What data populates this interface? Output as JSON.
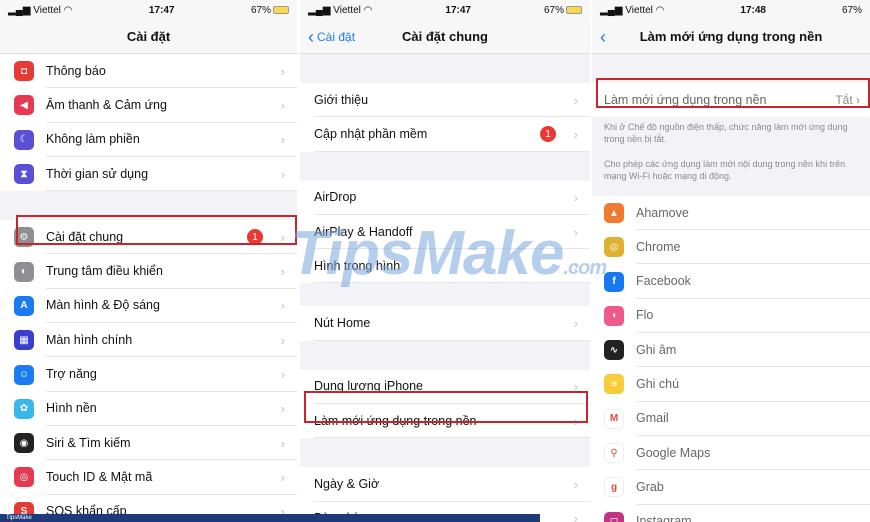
{
  "panel1": {
    "status": {
      "carrier": "Viettel",
      "time": "17:47",
      "battery": "67%"
    },
    "title": "Cài đặt",
    "group1": [
      {
        "label": "Thông báo",
        "icon": "bell-icon",
        "color": "#e63a35"
      },
      {
        "label": "Âm thanh & Cảm ứng",
        "icon": "speaker-icon",
        "color": "#e63a53"
      },
      {
        "label": "Không làm phiền",
        "icon": "moon-icon",
        "color": "#5b4fd6"
      },
      {
        "label": "Thời gian sử dụng",
        "icon": "hourglass-icon",
        "color": "#5b4fd6"
      }
    ],
    "group2": [
      {
        "label": "Cài đặt chung",
        "icon": "gear-icon",
        "color": "#8e8e93",
        "badge": "1"
      },
      {
        "label": "Trung tâm điều khiển",
        "icon": "toggles-icon",
        "color": "#8e8e93"
      },
      {
        "label": "Màn hình & Độ sáng",
        "icon": "text-size-icon",
        "color": "#1a7cf0"
      },
      {
        "label": "Màn hình chính",
        "icon": "grid-icon",
        "color": "#3b3fd0"
      },
      {
        "label": "Trợ năng",
        "icon": "accessibility-icon",
        "color": "#1a7cf0"
      },
      {
        "label": "Hình nền",
        "icon": "flower-icon",
        "color": "#38b8e8"
      },
      {
        "label": "Siri & Tìm kiếm",
        "icon": "siri-icon",
        "color": "#222"
      },
      {
        "label": "Touch ID & Mật mã",
        "icon": "fingerprint-icon",
        "color": "#e63a53"
      },
      {
        "label": "SOS khẩn cấp",
        "icon": "sos-icon",
        "color": "#e63a35"
      }
    ]
  },
  "panel2": {
    "status": {
      "carrier": "Viettel",
      "time": "17:47",
      "battery": "67%"
    },
    "back": "Cài đặt",
    "title": "Cài đặt chung",
    "group1": [
      {
        "label": "Giới thiệu"
      },
      {
        "label": "Cập nhật phần mềm",
        "badge": "1"
      }
    ],
    "group2": [
      {
        "label": "AirDrop"
      },
      {
        "label": "AirPlay & Handoff"
      },
      {
        "label": "Hình trong hình"
      }
    ],
    "group3": [
      {
        "label": "Nút Home"
      }
    ],
    "group4": [
      {
        "label": "Dung lượng iPhone"
      },
      {
        "label": "Làm mới ứng dụng trong nền"
      }
    ],
    "group5": [
      {
        "label": "Ngày & Giờ"
      },
      {
        "label": "Bàn phím"
      }
    ]
  },
  "panel3": {
    "status": {
      "carrier": "Viettel",
      "time": "17:48",
      "battery": "67%"
    },
    "title": "Làm mới ứng dụng trong nền",
    "setting": {
      "label": "Làm mới ứng dụng trong nền",
      "value": "Tắt"
    },
    "note1": "Khi ở Chế độ nguồn điện thấp, chức năng làm mới ứng dụng trong nền bị tắt.",
    "note2": "Cho phép các ứng dụng làm mới nội dung trong nền khi trên mạng Wi-Fi hoặc mạng di động.",
    "apps": [
      {
        "label": "Ahamove",
        "icon": "ahamove-icon",
        "color": "#f07a30"
      },
      {
        "label": "Chrome",
        "icon": "chrome-icon",
        "color": "#e0b030"
      },
      {
        "label": "Facebook",
        "icon": "facebook-icon",
        "color": "#1877f2"
      },
      {
        "label": "Flo",
        "icon": "flo-icon",
        "color": "#f05a8a"
      },
      {
        "label": "Ghi âm",
        "icon": "voice-memo-icon",
        "color": "#222"
      },
      {
        "label": "Ghi chú",
        "icon": "notes-icon",
        "color": "#f7cc3a"
      },
      {
        "label": "Gmail",
        "icon": "gmail-icon",
        "color": "#ffffff"
      },
      {
        "label": "Google Maps",
        "icon": "maps-icon",
        "color": "#ffffff"
      },
      {
        "label": "Grab",
        "icon": "grab-icon",
        "color": "#ffffff"
      },
      {
        "label": "Instagram",
        "icon": "instagram-icon",
        "color": "#c13584"
      }
    ]
  },
  "watermark": {
    "text": "TipsMake",
    "suffix": ".com"
  },
  "footer": "TipsMake"
}
